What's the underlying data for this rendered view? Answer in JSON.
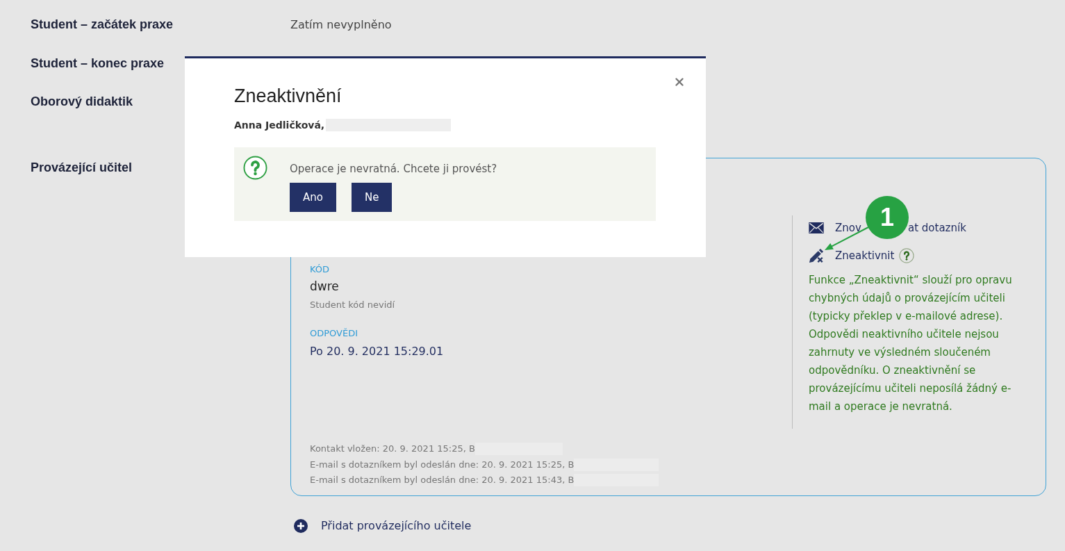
{
  "rows": [
    {
      "label": "Student – začátek praxe",
      "value": "Zatím nevyplněno"
    },
    {
      "label": "Student – konec praxe"
    },
    {
      "label": "Oborový didaktik"
    }
  ],
  "teacher": {
    "label": "Provázející učitel",
    "fields": [
      {
        "label": "KÓD",
        "value": "dwre",
        "note": "Student kód nevidí"
      },
      {
        "label": "ODPOVĚDI",
        "value": "Po 20. 9. 2021 15:29.01"
      }
    ],
    "actions": [
      {
        "kind": "resend",
        "parts": [
          "Znov",
          "at dotazník"
        ]
      },
      {
        "kind": "deactivate",
        "label": "Zneaktivnit",
        "help": true
      }
    ],
    "help_text": "Funkce „Zneaktivnit“ slouží pro opravu chybných údajů o provázejícím učiteli (typicky překlep v e-mailové adrese). Odpovědi neaktivního učitele nejsou zahrnuty ve výsledném sloučeném odpovědníku. O zneaktivnění se provázejícímu učiteli neposílá žádný e-mail a operace je nevratná.",
    "log": [
      {
        "text": "Kontakt vložen: 20. 9. 2021 15:25, B",
        "redacted": true
      },
      {
        "text": "E-mail s dotazníkem byl odeslán dne: 20. 9. 2021 15:25, B",
        "redacted": true
      },
      {
        "text": "E-mail s dotazníkem byl odeslán dne: 20. 9. 2021 15:43, B",
        "redacted": true
      }
    ],
    "add_link": "Přidat provázejícího učitele"
  },
  "modal": {
    "title": "Zneaktivnění",
    "person": "Anna Jedličková,",
    "email_redacted": true,
    "message": "Operace je nevratná. Chcete ji provést?",
    "buttons": [
      "Ano",
      "Ne"
    ]
  },
  "annotation": {
    "label": "1"
  }
}
